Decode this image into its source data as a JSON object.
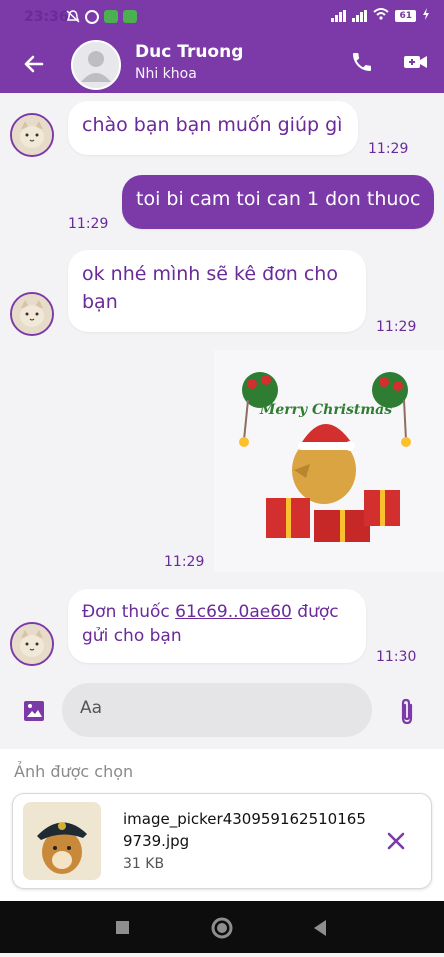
{
  "status_bar": {
    "time": "23:36",
    "battery": "61"
  },
  "header": {
    "contact_name": "Duc Truong",
    "contact_subtitle": "Nhi khoa"
  },
  "messages": [
    {
      "direction": "in",
      "text": "chào bạn bạn muốn giúp gì",
      "time": "11:29"
    },
    {
      "direction": "out",
      "text": "toi bi cam toi can 1 don thuoc",
      "time": "11:29"
    },
    {
      "direction": "in",
      "text": "ok nhé mình sẽ kê đơn cho bạn",
      "time": "11:29"
    },
    {
      "direction": "out",
      "type": "sticker",
      "sticker_text": "Merry Christmas",
      "time": "11:29"
    },
    {
      "direction": "in",
      "text_before": "Đơn thuốc ",
      "link": "61c69..0ae60",
      "text_after": " được gửi cho bạn",
      "time": "11:30"
    }
  ],
  "composer": {
    "placeholder": "Aa"
  },
  "selected": {
    "label": "Ảnh được chọn",
    "file_name": "image_picker4309591625101659739.jpg",
    "file_size": "31 KB"
  },
  "colors": {
    "primary": "#7b3aa8",
    "bubble_in": "#ffffff",
    "bubble_out": "#7b3aa8",
    "text_purple": "#6a2a9a"
  },
  "icons": [
    "arrow-left-icon",
    "phone-icon",
    "video-camera-icon",
    "image-icon",
    "paperclip-icon",
    "close-icon",
    "square-icon",
    "circle-icon",
    "triangle-back-icon"
  ]
}
